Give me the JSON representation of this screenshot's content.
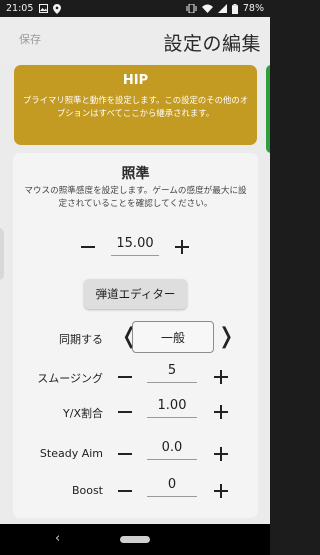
{
  "status_bar": {
    "time": "21:05",
    "battery": "78%",
    "icons": [
      "image-icon",
      "location-icon",
      "vibrate-icon",
      "wifi-icon",
      "signal-icon",
      "battery-icon"
    ]
  },
  "header": {
    "save_label": "保存",
    "title": "設定の編集"
  },
  "hip_card": {
    "title": "HIP",
    "description": "プライマリ照準と動作を設定します。この設定のその他のオプションはすべてここから継承されます。",
    "color": "#c39a22"
  },
  "aim_section": {
    "title": "照準",
    "description": "マウスの照準感度を設定します。ゲームの感度が最大に設定されていることを確認してください。",
    "sensitivity_value": "15.00",
    "ballistic_button_label": "弾道エディター",
    "sync": {
      "label": "同期する",
      "value": "一般"
    },
    "rows": {
      "smoothing": {
        "label": "スムージング",
        "value": "5"
      },
      "yx_ratio": {
        "label": "Y/X割合",
        "value": "1.00"
      },
      "steady_aim": {
        "label": "Steady Aim",
        "value": "0.0"
      },
      "boost": {
        "label": "Boost",
        "value": "0"
      }
    }
  },
  "colors": {
    "accent_gold": "#c39a22",
    "accent_green": "#2e9e3f",
    "background": "#ebebeb"
  }
}
